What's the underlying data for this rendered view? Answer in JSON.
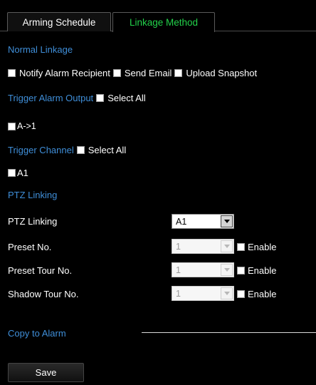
{
  "tabs": [
    {
      "label": "Arming Schedule",
      "active": false
    },
    {
      "label": "Linkage Method",
      "active": true
    }
  ],
  "normal_linkage": {
    "heading": "Normal Linkage",
    "options": [
      {
        "label": "Notify Alarm Recipient",
        "checked": false
      },
      {
        "label": "Send Email",
        "checked": false
      },
      {
        "label": "Upload Snapshot",
        "checked": false
      }
    ]
  },
  "trigger_alarm_output": {
    "heading": "Trigger Alarm Output",
    "select_all_label": "Select All",
    "items": [
      {
        "label": "A->1",
        "checked": false
      }
    ]
  },
  "trigger_channel": {
    "heading": "Trigger Channel",
    "select_all_label": "Select All",
    "items": [
      {
        "label": "A1",
        "checked": false
      }
    ]
  },
  "ptz": {
    "heading": "PTZ Linking",
    "rows": [
      {
        "label": "PTZ Linking",
        "value": "A1",
        "enabled": true
      },
      {
        "label": "Preset No.",
        "value": "1",
        "enabled": false,
        "enable_label": "Enable"
      },
      {
        "label": "Preset Tour No.",
        "value": "1",
        "enabled": false,
        "enable_label": "Enable"
      },
      {
        "label": "Shadow Tour No.",
        "value": "1",
        "enabled": false,
        "enable_label": "Enable"
      }
    ]
  },
  "copy_to_alarm": {
    "label": "Copy to Alarm"
  },
  "save_button": {
    "label": "Save"
  },
  "colors": {
    "background": "#000000",
    "section_heading": "#3f8ed8",
    "active_tab": "#22d14a",
    "text": "#ffffff"
  }
}
